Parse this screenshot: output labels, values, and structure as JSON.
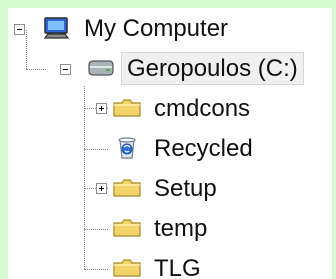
{
  "tree": {
    "root": {
      "label": "My Computer",
      "icon": "computer-icon",
      "expanded": true
    },
    "drive": {
      "label": "Geropoulos (C:)",
      "icon": "drive-icon",
      "expanded": true,
      "selected": true
    },
    "items": [
      {
        "label": "cmdcons",
        "icon": "folder-icon",
        "expander": "plus"
      },
      {
        "label": "Recycled",
        "icon": "recycle-bin-icon",
        "expander": "none"
      },
      {
        "label": "Setup",
        "icon": "folder-icon",
        "expander": "plus"
      },
      {
        "label": "temp",
        "icon": "folder-icon",
        "expander": "none"
      },
      {
        "label": "TLG",
        "icon": "folder-icon",
        "expander": "none"
      }
    ]
  },
  "colors": {
    "background": "#d4fbd0",
    "panel": "#ffffff",
    "selection": "#f0f0f0",
    "folder": "#f4d36b",
    "folder_outline": "#a88a24",
    "drive": "#a9b3b8",
    "computer_screen": "#3266d6"
  }
}
